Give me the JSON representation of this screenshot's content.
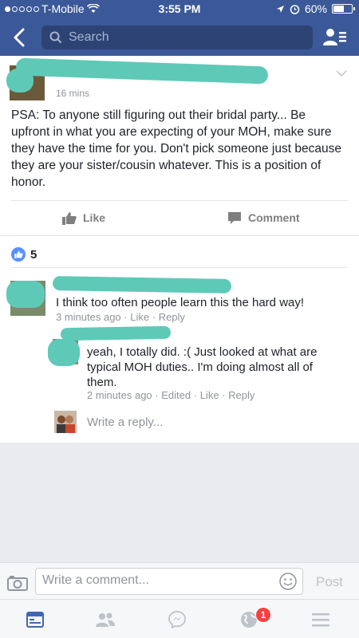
{
  "status_bar": {
    "carrier": "T-Mobile",
    "time": "3:55 PM",
    "battery": "60%",
    "battery_level": 0.6
  },
  "header": {
    "search_placeholder": "Search",
    "back_icon": "back-chevron-icon",
    "friends_icon": "friend-requests-icon"
  },
  "post": {
    "timestamp": "16 mins",
    "text": "PSA: To anyone still figuring out their bridal party... Be upfront in what you are expecting of your MOH, make sure they have the time for you. Don't pick someone just because they are your sister/cousin whatever. This is a position of honor.",
    "like_label": "Like",
    "comment_label": "Comment",
    "reaction_count": "5"
  },
  "comments": [
    {
      "text": "I think too often people learn this the hard way!",
      "time": "3 minutes ago",
      "actions": [
        "Like",
        "Reply"
      ]
    },
    {
      "text": "yeah, I totally did. :( Just looked at what are typical MOH duties.. I'm doing almost all of them.",
      "time": "2 minutes ago",
      "edited": "Edited",
      "actions": [
        "Like",
        "Reply"
      ]
    }
  ],
  "reply_placeholder": "Write a reply...",
  "comment_bar": {
    "placeholder": "Write a comment...",
    "post_label": "Post"
  },
  "tabbar": {
    "notifications_badge": "1"
  },
  "colors": {
    "brand_blue": "#3b5998",
    "censor_teal": "#5fc9b8",
    "badge_red": "#fa3e3e"
  }
}
